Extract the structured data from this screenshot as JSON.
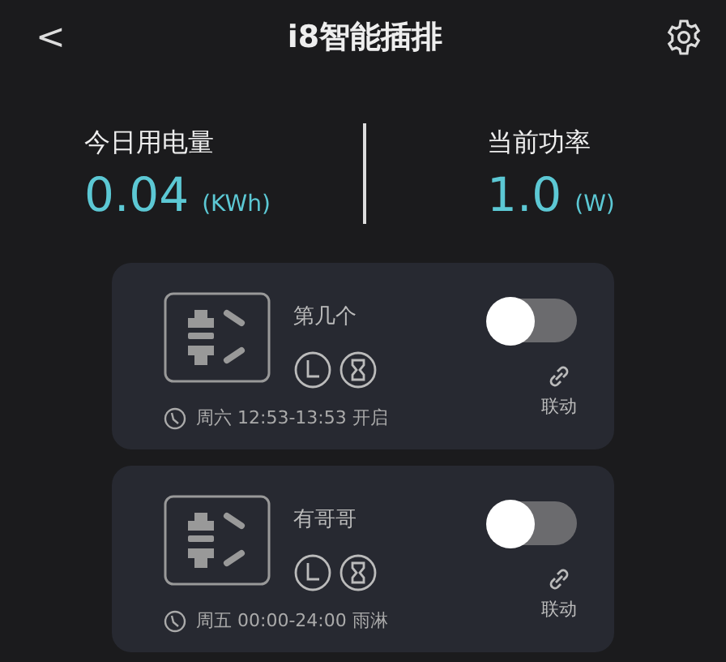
{
  "header": {
    "back": "<",
    "title": "i8智能插排"
  },
  "stats": [
    {
      "label": "今日用电量",
      "value": "0.04",
      "unit": "(KWh)"
    },
    {
      "label": "当前功率",
      "value": "1.0",
      "unit": "(W)"
    }
  ],
  "sockets": [
    {
      "name": "第几个",
      "on": false,
      "schedule": "周六 12:53-13:53 开启",
      "link": "联动"
    },
    {
      "name": "有哥哥",
      "on": false,
      "schedule": "周五 00:00-24:00 雨淋",
      "link": "联动"
    }
  ]
}
